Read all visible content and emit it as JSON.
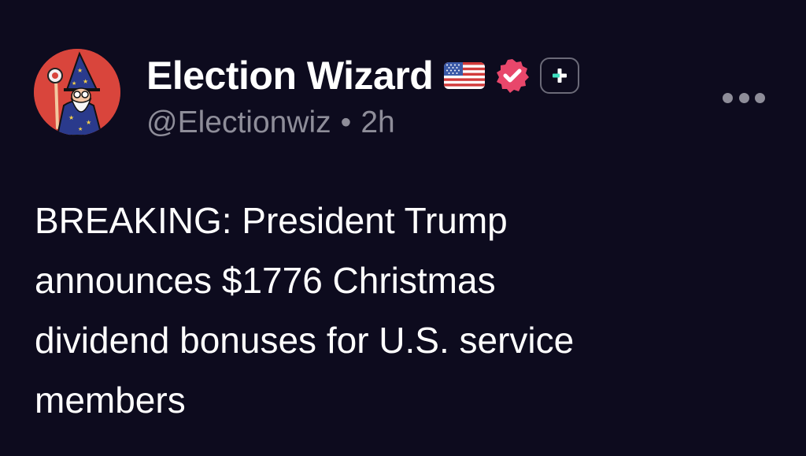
{
  "post": {
    "author": {
      "display_name": "Election Wizard",
      "handle": "@Electionwiz",
      "avatar_icon": "wizard-avatar",
      "flag_icon": "us-flag-emoji",
      "verified_icon": "verified-badge-icon",
      "follow_icon": "plus-icon"
    },
    "separator": "•",
    "time_ago": "2h",
    "more_icon": "more-options-icon",
    "text": "BREAKING: President Trump\nannounces $1776 Christmas\ndividend bonuses for U.S. service\nmembers"
  },
  "colors": {
    "background": "#0d0b1e",
    "text_primary": "#ffffff",
    "text_secondary": "#8e8d99",
    "avatar_bg": "#d9453c",
    "verified_badge": "#e8476b",
    "follow_accent": "#3ee0c0"
  }
}
